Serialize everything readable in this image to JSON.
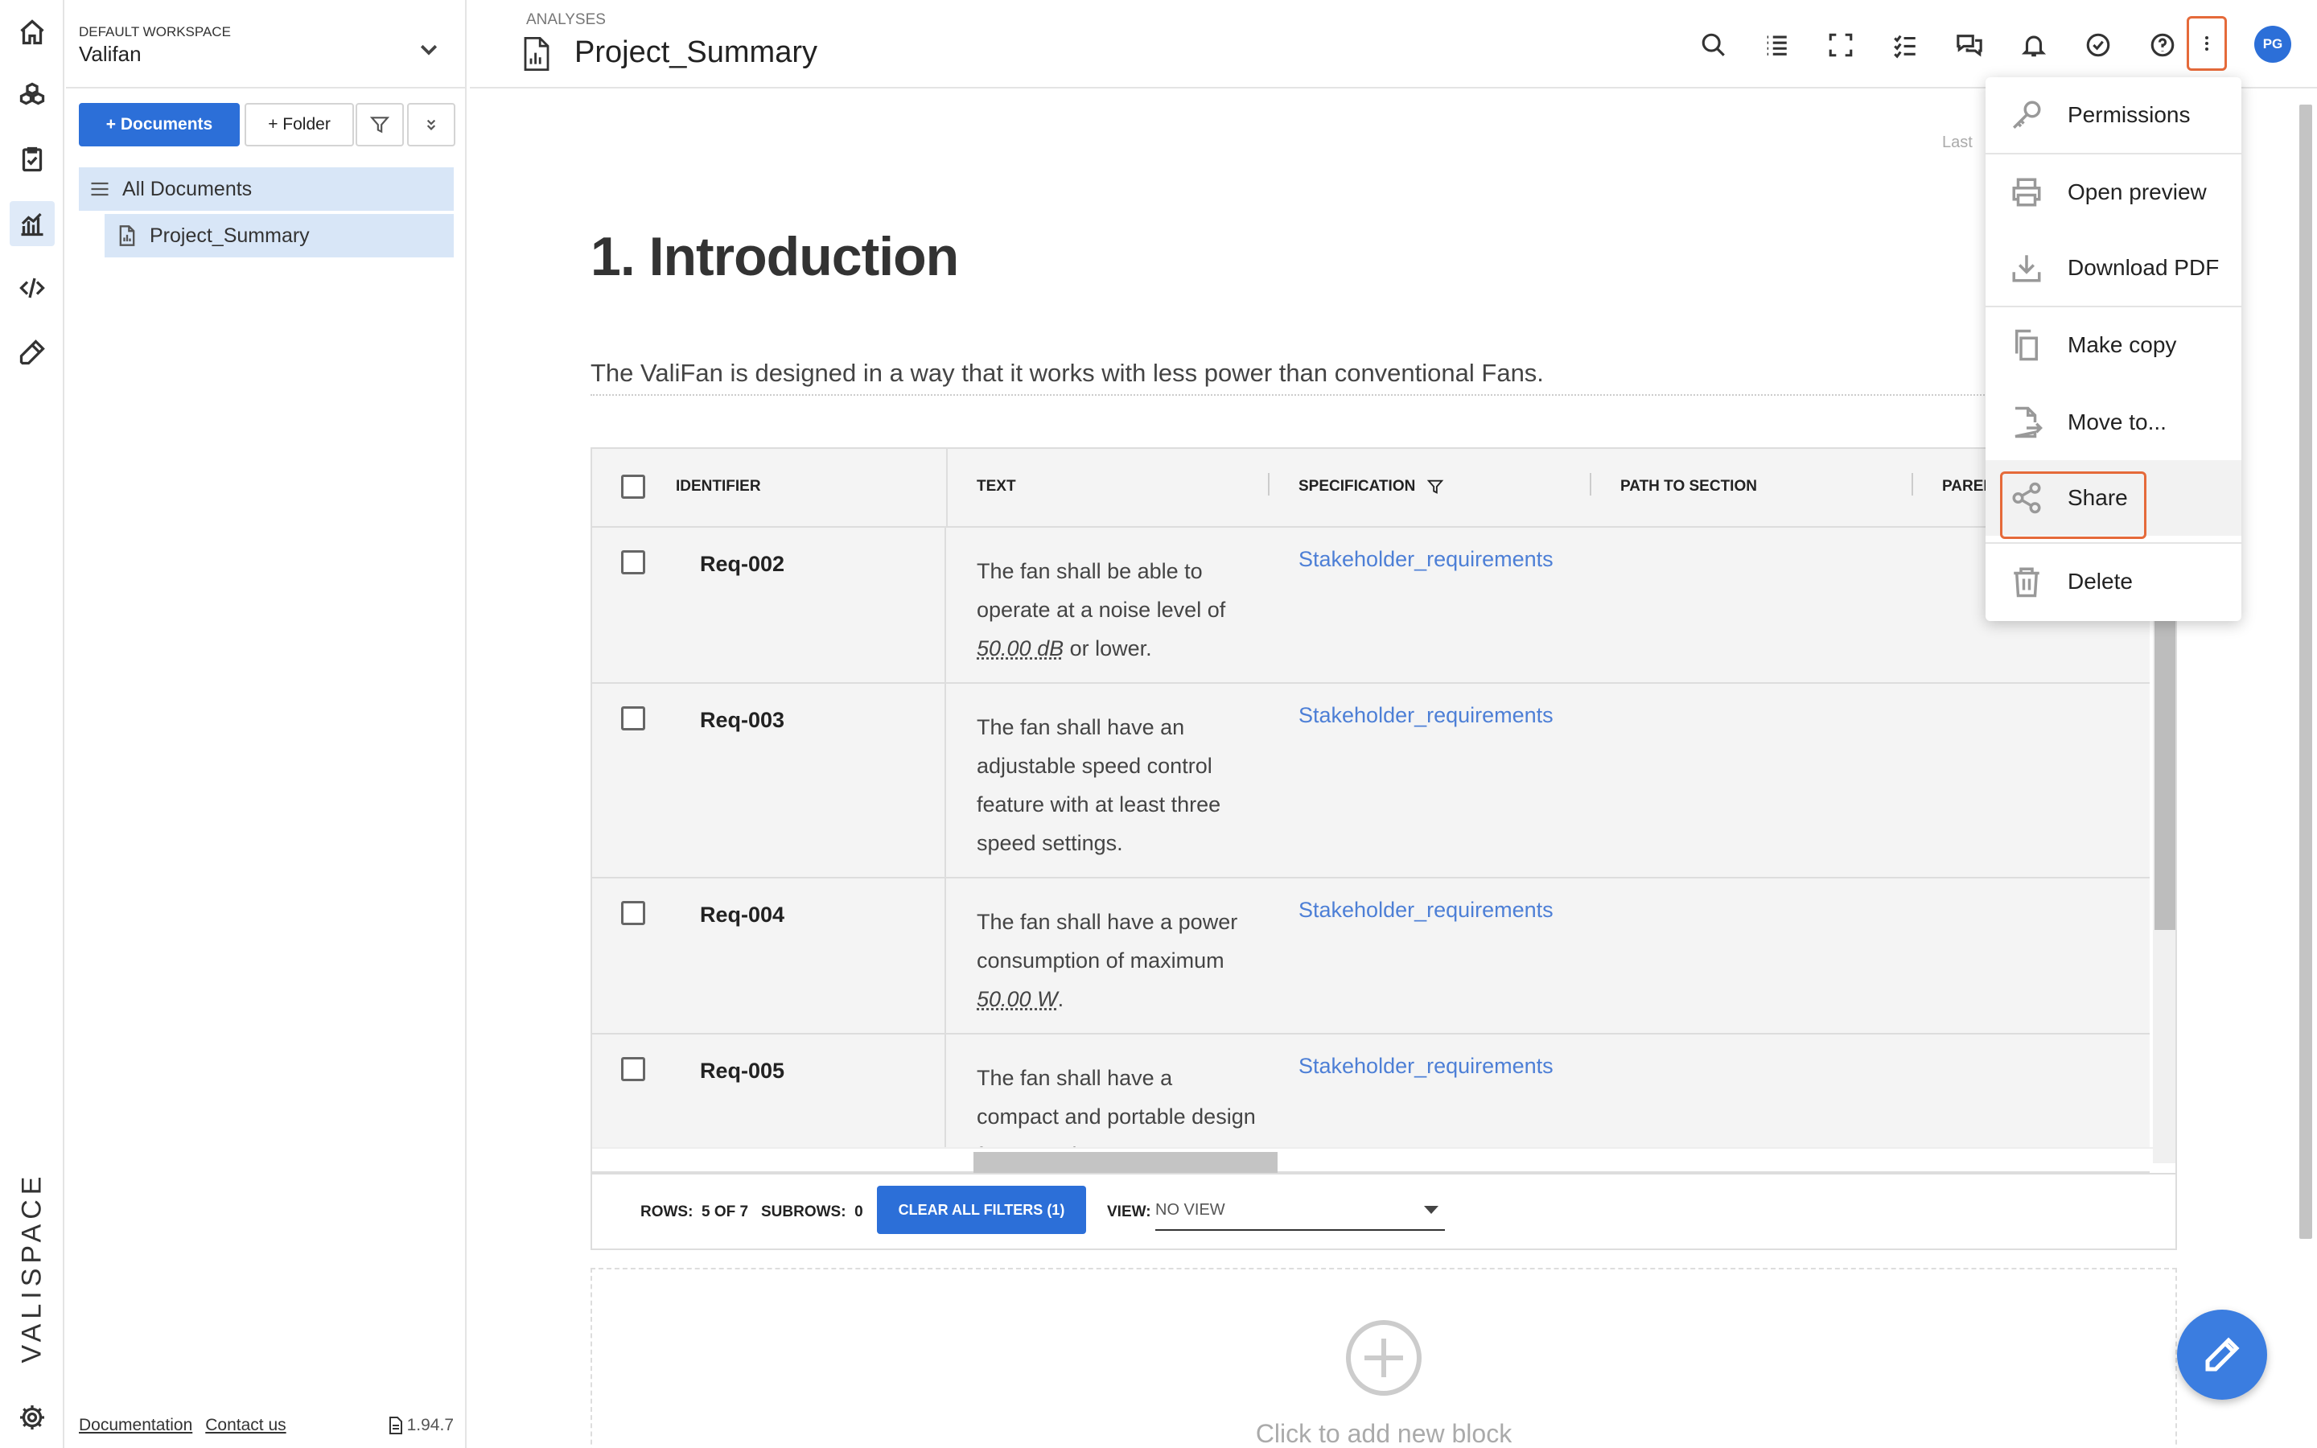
{
  "workspace": {
    "label": "DEFAULT WORKSPACE",
    "name": "Valifan"
  },
  "sidebar": {
    "documents_button": "+ Documents",
    "folder_button": "+ Folder",
    "tree": [
      {
        "label": "All Documents"
      },
      {
        "label": "Project_Summary"
      }
    ],
    "footer": {
      "documentation": "Documentation",
      "contact": "Contact us",
      "version": "1.94.7"
    }
  },
  "brand": {
    "name": "VALISPACE"
  },
  "header": {
    "breadcrumb": "ANALYSES",
    "title": "Project_Summary",
    "avatar": "PG"
  },
  "content": {
    "last_modified_partial": "Last",
    "heading": "1. Introduction",
    "paragraph": "The ValiFan is designed in a way that it works with less power than conventional Fans."
  },
  "table": {
    "columns": [
      "IDENTIFIER",
      "TEXT",
      "SPECIFICATION",
      "PATH TO SECTION",
      "PAREN"
    ],
    "rows": [
      {
        "id": "Req-002",
        "text_parts": [
          "The fan shall be able to operate at a noise level of ",
          "50.00  dB",
          " or lower."
        ],
        "specification": "Stakeholder_requirements"
      },
      {
        "id": "Req-003",
        "text_parts": [
          "The fan shall have an adjustable speed control feature with at least three speed settings.",
          "",
          ""
        ],
        "specification": "Stakeholder_requirements"
      },
      {
        "id": "Req-004",
        "text_parts": [
          "The fan shall have a power consumption of maximum ",
          "50.00  W",
          "."
        ],
        "specification": "Stakeholder_requirements"
      },
      {
        "id": "Req-005",
        "text_parts": [
          "The fan shall have a compact and portable design for easy placement",
          "",
          ""
        ],
        "specification": "Stakeholder_requirements"
      }
    ],
    "footer": {
      "rows_label": "ROWS:",
      "rows_value": "5 OF 7",
      "subrows_label": "SUBROWS:",
      "subrows_value": "0",
      "clear_filters": "CLEAR ALL FILTERS (1)",
      "view_label": "VIEW:",
      "view_value": "NO VIEW"
    }
  },
  "add_block": {
    "label": "Click to add new block"
  },
  "menu": {
    "items": [
      {
        "label": "Permissions",
        "icon": "key-icon"
      },
      {
        "label": "Open preview",
        "icon": "printer-icon"
      },
      {
        "label": "Download PDF",
        "icon": "download-icon"
      },
      {
        "label": "Make copy",
        "icon": "copy-icon"
      },
      {
        "label": "Move to...",
        "icon": "move-file-icon"
      },
      {
        "label": "Share",
        "icon": "share-icon"
      },
      {
        "label": "Delete",
        "icon": "trash-icon"
      }
    ]
  },
  "colors": {
    "accent": "#2c6fd8",
    "highlight": "#e56a3a",
    "link": "#4d7fd6",
    "tree_selected": "#d8e6f7"
  }
}
